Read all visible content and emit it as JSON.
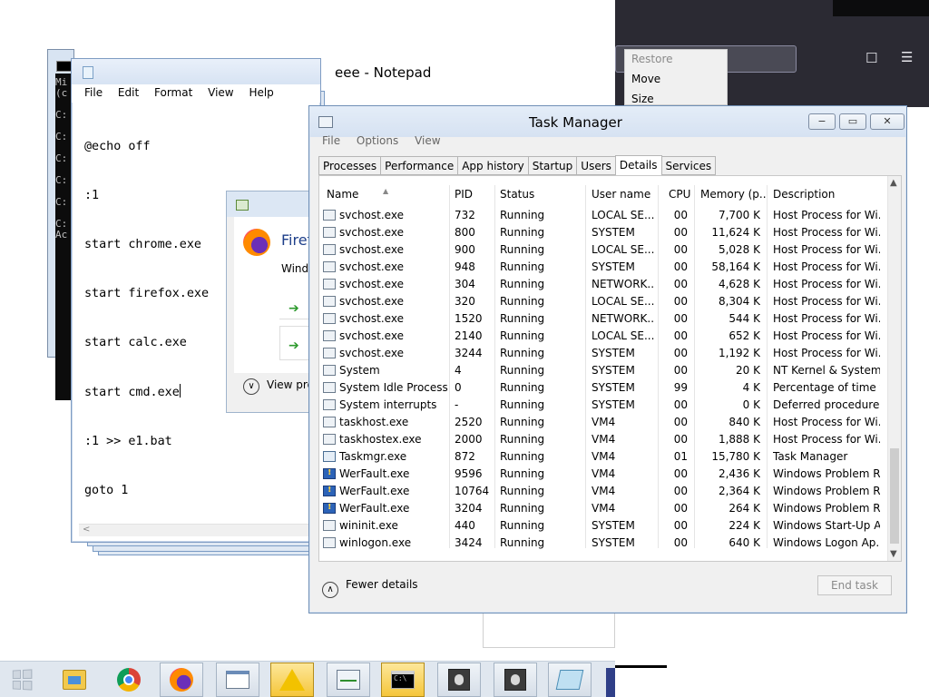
{
  "browser": {
    "system_menu": {
      "restore": "Restore",
      "move": "Move",
      "size": "Size"
    }
  },
  "cmd": {
    "lines": [
      "Mi",
      "(c",
      "",
      "C:",
      "",
      "C:",
      "",
      "C:",
      "",
      "C:",
      "",
      "C:",
      "",
      "C:",
      "Ac"
    ]
  },
  "notepad": {
    "title": "eee - Notepad",
    "menu": [
      "File",
      "Edit",
      "Format",
      "View",
      "Help"
    ],
    "lines": [
      "@echo off",
      ":1",
      "start chrome.exe",
      "start firefox.exe",
      "start calc.exe",
      "start cmd.exe",
      ":1 >> e1.bat",
      "goto 1"
    ]
  },
  "firefox_dialog": {
    "title_partial": "Firef",
    "subtitle_partial": "Windo",
    "view_more_partial": "View pro"
  },
  "task_manager": {
    "title": "Task Manager",
    "menu": [
      "File",
      "Options",
      "View"
    ],
    "tabs": [
      "Processes",
      "Performance",
      "App history",
      "Startup",
      "Users",
      "Details",
      "Services"
    ],
    "active_tab": "Details",
    "columns": [
      "Name",
      "PID",
      "Status",
      "User name",
      "CPU",
      "Memory (p...",
      "Description"
    ],
    "rows": [
      {
        "icon": "generic",
        "name": "svchost.exe",
        "pid": "732",
        "status": "Running",
        "user": "LOCAL SE...",
        "cpu": "00",
        "mem": "7,700 K",
        "desc": "Host Process for Wi..."
      },
      {
        "icon": "generic",
        "name": "svchost.exe",
        "pid": "800",
        "status": "Running",
        "user": "SYSTEM",
        "cpu": "00",
        "mem": "11,624 K",
        "desc": "Host Process for Wi..."
      },
      {
        "icon": "generic",
        "name": "svchost.exe",
        "pid": "900",
        "status": "Running",
        "user": "LOCAL SE...",
        "cpu": "00",
        "mem": "5,028 K",
        "desc": "Host Process for Wi..."
      },
      {
        "icon": "generic",
        "name": "svchost.exe",
        "pid": "948",
        "status": "Running",
        "user": "SYSTEM",
        "cpu": "00",
        "mem": "58,164 K",
        "desc": "Host Process for Wi..."
      },
      {
        "icon": "generic",
        "name": "svchost.exe",
        "pid": "304",
        "status": "Running",
        "user": "NETWORK...",
        "cpu": "00",
        "mem": "4,628 K",
        "desc": "Host Process for Wi..."
      },
      {
        "icon": "generic",
        "name": "svchost.exe",
        "pid": "320",
        "status": "Running",
        "user": "LOCAL SE...",
        "cpu": "00",
        "mem": "8,304 K",
        "desc": "Host Process for Wi..."
      },
      {
        "icon": "generic",
        "name": "svchost.exe",
        "pid": "1520",
        "status": "Running",
        "user": "NETWORK...",
        "cpu": "00",
        "mem": "544 K",
        "desc": "Host Process for Wi..."
      },
      {
        "icon": "generic",
        "name": "svchost.exe",
        "pid": "2140",
        "status": "Running",
        "user": "LOCAL SE...",
        "cpu": "00",
        "mem": "652 K",
        "desc": "Host Process for Wi..."
      },
      {
        "icon": "generic",
        "name": "svchost.exe",
        "pid": "3244",
        "status": "Running",
        "user": "SYSTEM",
        "cpu": "00",
        "mem": "1,192 K",
        "desc": "Host Process for Wi..."
      },
      {
        "icon": "generic",
        "name": "System",
        "pid": "4",
        "status": "Running",
        "user": "SYSTEM",
        "cpu": "00",
        "mem": "20 K",
        "desc": "NT Kernel & System"
      },
      {
        "icon": "generic",
        "name": "System Idle Process",
        "pid": "0",
        "status": "Running",
        "user": "SYSTEM",
        "cpu": "99",
        "mem": "4 K",
        "desc": "Percentage of time t..."
      },
      {
        "icon": "generic",
        "name": "System interrupts",
        "pid": "-",
        "status": "Running",
        "user": "SYSTEM",
        "cpu": "00",
        "mem": "0 K",
        "desc": "Deferred procedure ..."
      },
      {
        "icon": "generic",
        "name": "taskhost.exe",
        "pid": "2520",
        "status": "Running",
        "user": "VM4",
        "cpu": "00",
        "mem": "840 K",
        "desc": "Host Process for Wi..."
      },
      {
        "icon": "generic",
        "name": "taskhostex.exe",
        "pid": "2000",
        "status": "Running",
        "user": "VM4",
        "cpu": "00",
        "mem": "1,888 K",
        "desc": "Host Process for Wi..."
      },
      {
        "icon": "taskmgr",
        "name": "Taskmgr.exe",
        "pid": "872",
        "status": "Running",
        "user": "VM4",
        "cpu": "01",
        "mem": "15,780 K",
        "desc": "Task Manager"
      },
      {
        "icon": "wer",
        "name": "WerFault.exe",
        "pid": "9596",
        "status": "Running",
        "user": "VM4",
        "cpu": "00",
        "mem": "2,436 K",
        "desc": "Windows Problem R..."
      },
      {
        "icon": "wer",
        "name": "WerFault.exe",
        "pid": "10764",
        "status": "Running",
        "user": "VM4",
        "cpu": "00",
        "mem": "2,364 K",
        "desc": "Windows Problem R..."
      },
      {
        "icon": "wer",
        "name": "WerFault.exe",
        "pid": "3204",
        "status": "Running",
        "user": "VM4",
        "cpu": "00",
        "mem": "264 K",
        "desc": "Windows Problem R..."
      },
      {
        "icon": "generic",
        "name": "wininit.exe",
        "pid": "440",
        "status": "Running",
        "user": "SYSTEM",
        "cpu": "00",
        "mem": "224 K",
        "desc": "Windows Start-Up A..."
      },
      {
        "icon": "generic",
        "name": "winlogon.exe",
        "pid": "3424",
        "status": "Running",
        "user": "SYSTEM",
        "cpu": "00",
        "mem": "640 K",
        "desc": "Windows Logon Ap..."
      }
    ],
    "fewer_details": "Fewer details",
    "end_task": "End task"
  },
  "taskbar": {
    "icons": [
      "start-icon",
      "file-explorer-icon",
      "chrome-icon",
      "firefox-icon",
      "window-icon",
      "warning-icon",
      "task-manager-icon",
      "cmd-icon",
      "wer-icon",
      "wer-icon",
      "notepad-icon"
    ]
  }
}
